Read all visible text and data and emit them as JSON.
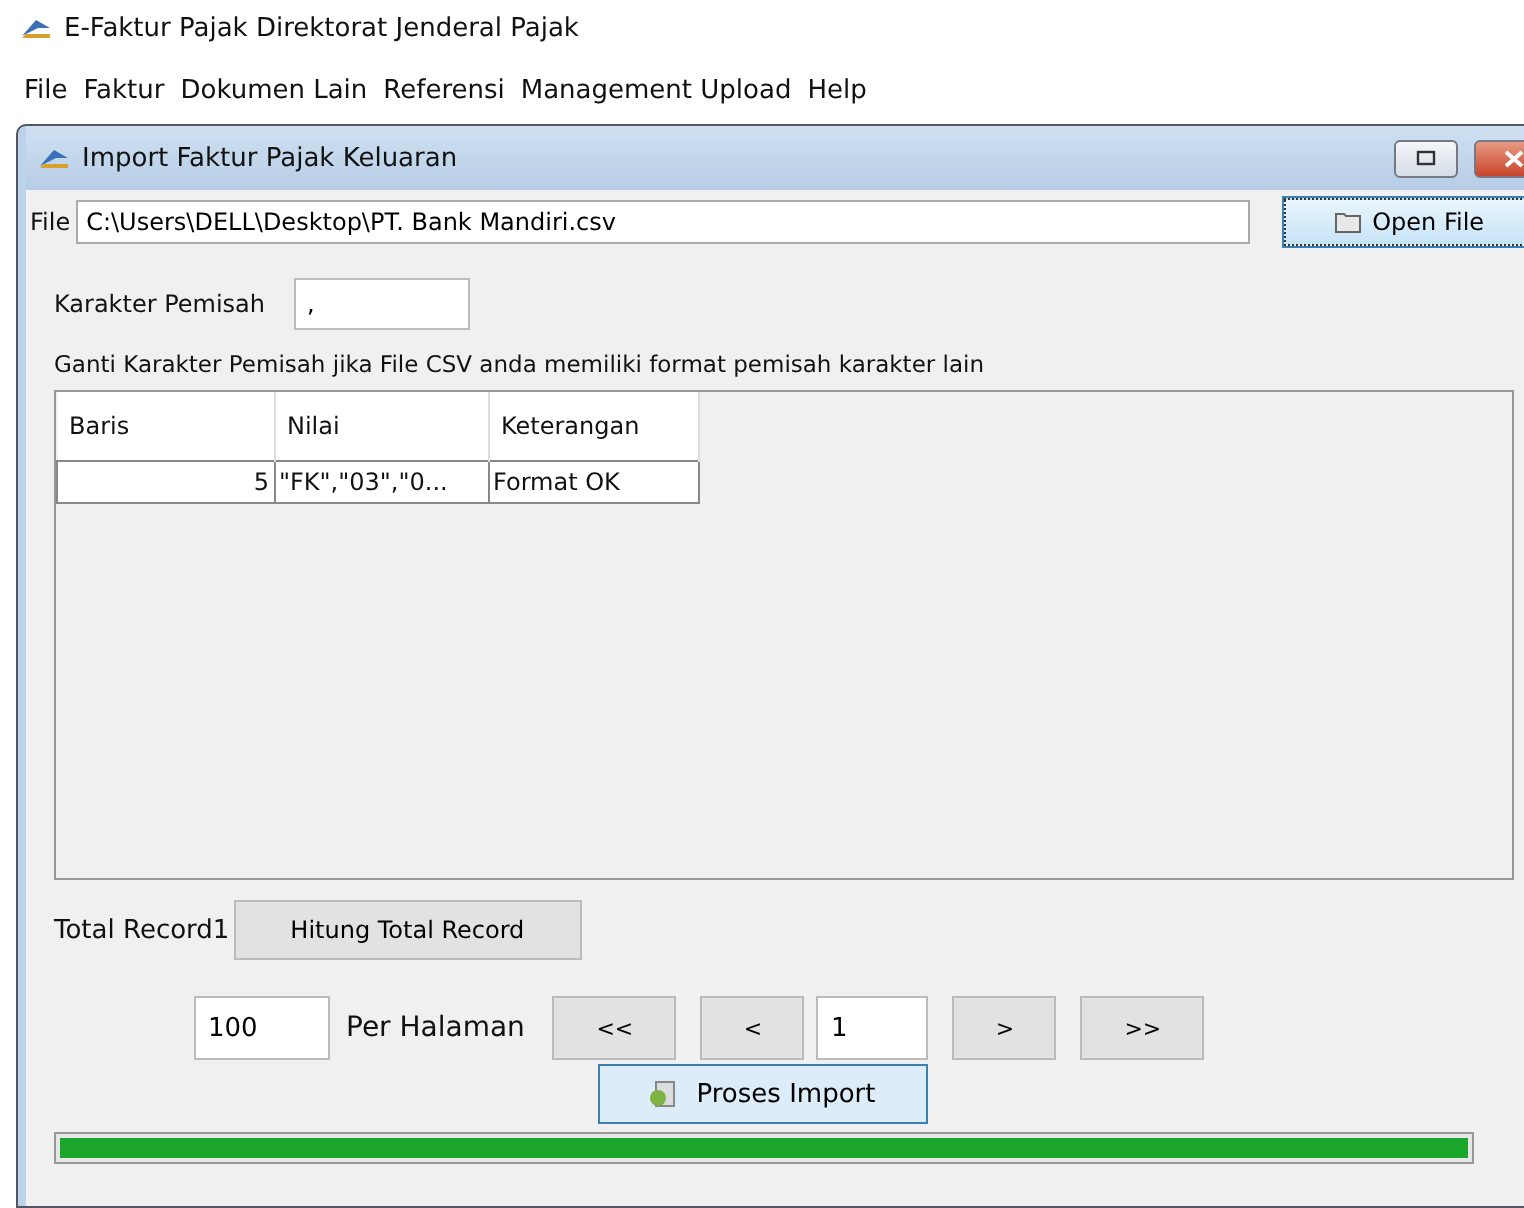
{
  "app": {
    "title": "E-Faktur Pajak Direktorat Jenderal Pajak"
  },
  "menu": [
    "File",
    "Faktur",
    "Dokumen Lain",
    "Referensi",
    "Management Upload",
    "Help"
  ],
  "window": {
    "title": "Import Faktur Pajak Keluaran"
  },
  "file": {
    "label": "File",
    "value": "C:\\Users\\DELL\\Desktop\\PT. Bank Mandiri.csv",
    "button": "Open File"
  },
  "separator": {
    "label": "Karakter Pemisah",
    "value": ","
  },
  "hint": "Ganti Karakter Pemisah jika File CSV anda memiliki format pemisah karakter lain",
  "table": {
    "columns": [
      "Baris",
      "Nilai",
      "Keterangan"
    ],
    "rows": [
      [
        "5",
        "\"FK\",\"03\",\"0...",
        "Format OK"
      ]
    ]
  },
  "total": {
    "label": "Total Record1",
    "button": "Hitung Total Record"
  },
  "pager": {
    "per_page": "100",
    "per_page_label": "Per Halaman",
    "first": "<<",
    "prev": "<",
    "page": "1",
    "next": ">",
    "last": ">>"
  },
  "process_button": "Proses Import",
  "progress": {
    "level": 1
  }
}
